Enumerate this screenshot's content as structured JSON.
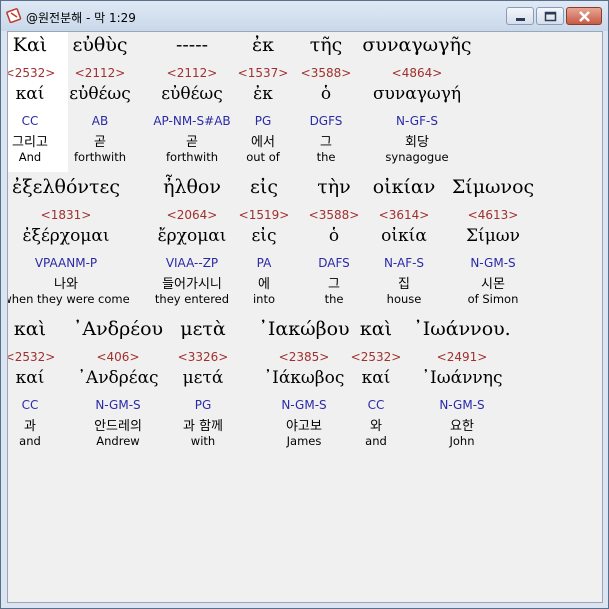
{
  "window": {
    "title": "@원전분해 - 막 1:29",
    "app_icon": "bible-app-icon",
    "controls": [
      "minimize-icon",
      "maximize-icon",
      "close-icon"
    ]
  },
  "rows": [
    {
      "words": [
        {
          "greek": "Καὶ",
          "strong": "<2532>",
          "lemma": "καί",
          "parse": "CC",
          "korean": "그리고",
          "english": "And"
        },
        {
          "greek": "εὐθὺς",
          "strong": "<2112>",
          "lemma": "εὐθέως",
          "parse": "AB",
          "korean": "곧",
          "english": "forthwith"
        },
        {
          "greek": "-----",
          "strong": "<2112>",
          "lemma": "εὐθέως",
          "parse": "AP-NM-S#AB",
          "korean": "곧",
          "english": "forthwith"
        },
        {
          "greek": "ἐκ",
          "strong": "<1537>",
          "lemma": "ἐκ",
          "parse": "PG",
          "korean": "에서",
          "english": "out of"
        },
        {
          "greek": "τῆς",
          "strong": "<3588>",
          "lemma": "ὁ",
          "parse": "DGFS",
          "korean": "그",
          "english": "the"
        },
        {
          "greek": "συναγωγῆς",
          "strong": "<4864>",
          "lemma": "συναγωγή",
          "parse": "N-GF-S",
          "korean": "회당",
          "english": "synagogue"
        }
      ]
    },
    {
      "words": [
        {
          "greek": "ἐξελθόντες",
          "strong": "<1831>",
          "lemma": "ἐξέρχομαι",
          "parse": "VPAANM-P",
          "korean": "나와",
          "english": "when they were come"
        },
        {
          "greek": "ἦλθον",
          "strong": "<2064>",
          "lemma": "ἔρχομαι",
          "parse": "VIAA--ZP",
          "korean": "들어가시니",
          "english": "they entered"
        },
        {
          "greek": "εἰς",
          "strong": "<1519>",
          "lemma": "εἰς",
          "parse": "PA",
          "korean": "에",
          "english": "into"
        },
        {
          "greek": "τὴν",
          "strong": "<3588>",
          "lemma": "ὁ",
          "parse": "DAFS",
          "korean": "그",
          "english": "the"
        },
        {
          "greek": "οἰκίαν",
          "strong": "<3614>",
          "lemma": "οἰκία",
          "parse": "N-AF-S",
          "korean": "집",
          "english": "house"
        },
        {
          "greek": "Σίμωνος",
          "strong": "<4613>",
          "lemma": "Σίμων",
          "parse": "N-GM-S",
          "korean": "시몬",
          "english": "of Simon"
        }
      ]
    },
    {
      "words": [
        {
          "greek": "καὶ",
          "strong": "<2532>",
          "lemma": "καί",
          "parse": "CC",
          "korean": "과",
          "english": "and"
        },
        {
          "greek": "᾿Ανδρέου",
          "strong": "<406>",
          "lemma": "᾿Ανδρέας",
          "parse": "N-GM-S",
          "korean": "안드레의",
          "english": "Andrew"
        },
        {
          "greek": "μετὰ",
          "strong": "<3326>",
          "lemma": "μετά",
          "parse": "PG",
          "korean": "과 함께",
          "english": "with"
        },
        {
          "greek": "᾿Ιακώβου",
          "strong": "<2385>",
          "lemma": "᾿Ιάκωβος",
          "parse": "N-GM-S",
          "korean": "야고보",
          "english": "James"
        },
        {
          "greek": "καὶ",
          "strong": "<2532>",
          "lemma": "καί",
          "parse": "CC",
          "korean": "와",
          "english": "and"
        },
        {
          "greek": "᾿Ιωάννου.",
          "strong": "<2491>",
          "lemma": "᾿Ιωάννης",
          "parse": "N-GM-S",
          "korean": "요한",
          "english": "John"
        }
      ]
    }
  ]
}
